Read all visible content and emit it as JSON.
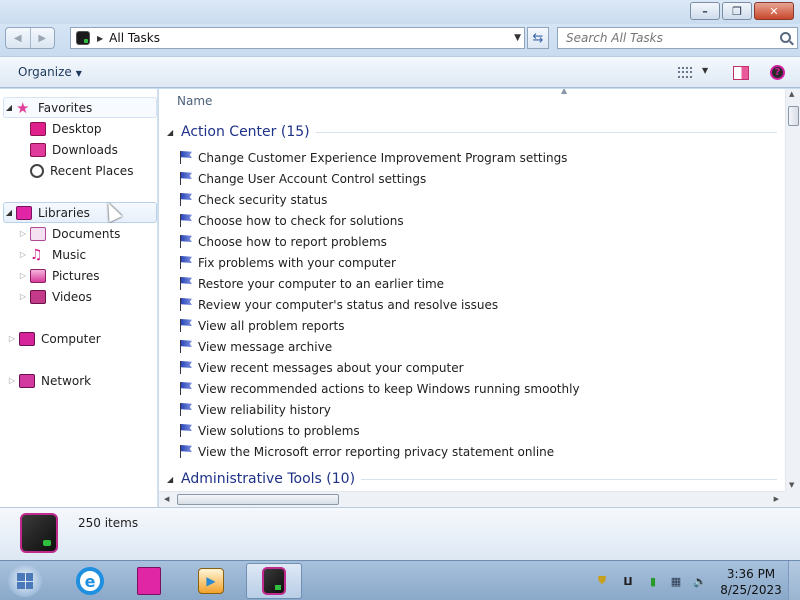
{
  "window": {
    "controls": {
      "minimize": "–",
      "maximize": "❐",
      "close": "✕"
    }
  },
  "address": {
    "path": "All Tasks",
    "search_placeholder": "Search All Tasks"
  },
  "toolbar": {
    "organize_label": "Organize"
  },
  "navigation": {
    "favorites": {
      "label": "Favorites",
      "items": [
        "Desktop",
        "Downloads",
        "Recent Places"
      ]
    },
    "libraries": {
      "label": "Libraries",
      "items": [
        "Documents",
        "Music",
        "Pictures",
        "Videos"
      ]
    },
    "computer": "Computer",
    "network": "Network"
  },
  "content": {
    "column_header": "Name",
    "groups": [
      {
        "title": "Action Center (15)",
        "items": [
          "Change Customer Experience Improvement Program settings",
          "Change User Account Control settings",
          "Check security status",
          "Choose how to check for solutions",
          "Choose how to report problems",
          "Fix problems with your computer",
          "Restore your computer to an earlier time",
          "Review your computer's status and resolve issues",
          "View all problem reports",
          "View message archive",
          "View recent messages about your computer",
          "View recommended actions to keep Windows running smoothly",
          "View reliability history",
          "View solutions to problems",
          "View the Microsoft error reporting privacy statement online"
        ]
      },
      {
        "title": "Administrative Tools (10)",
        "items": []
      }
    ]
  },
  "details": {
    "item_count": "250 items"
  },
  "taskbar": {
    "time": "3:36 PM",
    "date": "8/25/2023"
  },
  "colors": {
    "accent_pink": "#e026a5",
    "group_title": "#1e3287",
    "task_flag": "#2b46b8"
  }
}
